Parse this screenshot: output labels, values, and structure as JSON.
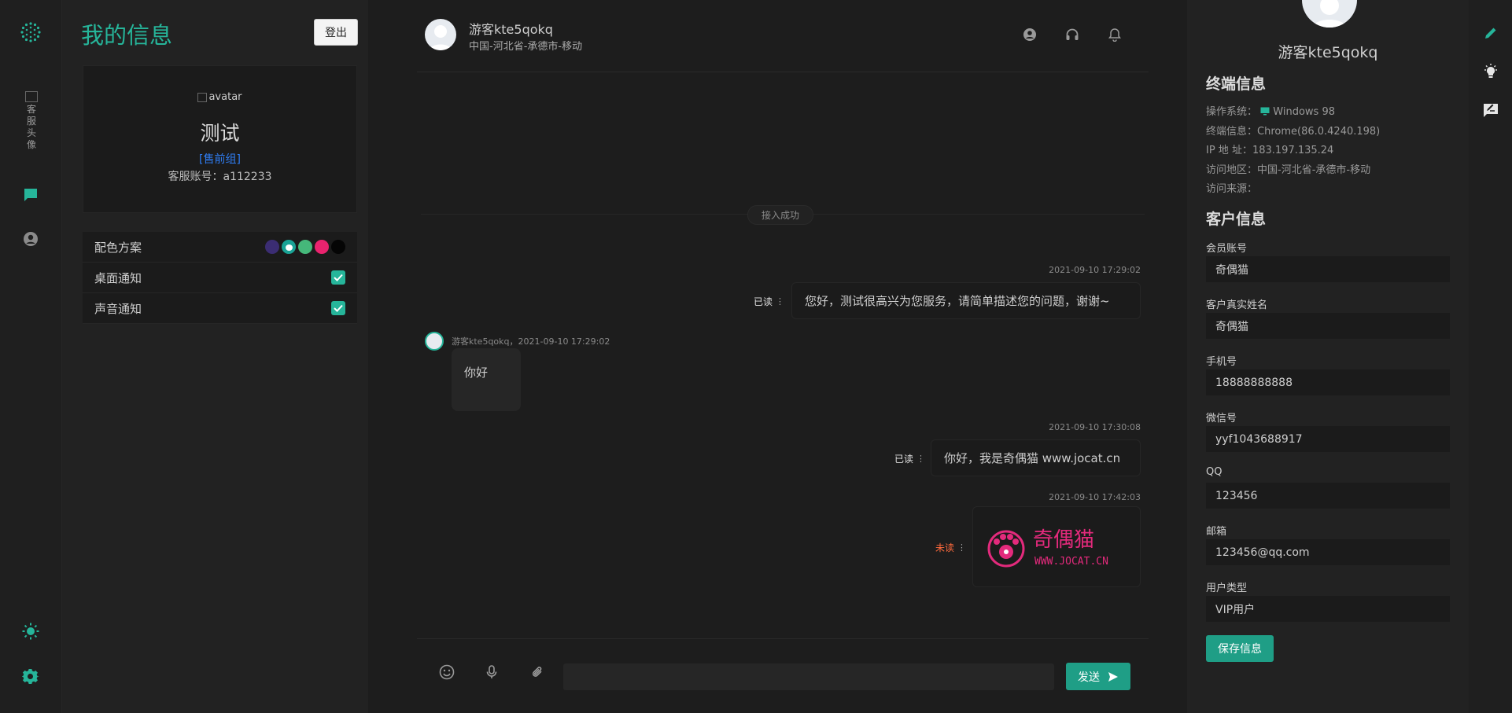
{
  "rail": {
    "avatar_alt": "客服头像",
    "icons": [
      "logo-icon",
      "chat-icon",
      "user-circle-icon",
      "sun-icon",
      "gear-icon"
    ]
  },
  "profile": {
    "title": "我的信息",
    "logout_label": "登出",
    "avatar_alt": "avatar",
    "name": "测试",
    "group": "[售前组]",
    "account": "客服账号：a112233",
    "settings": {
      "color_scheme_label": "配色方案",
      "desktop_notify_label": "桌面通知",
      "desktop_notify_checked": true,
      "sound_notify_label": "声音通知",
      "sound_notify_checked": true,
      "swatches": [
        "#3b2d73",
        "#1aa396",
        "#45b87a",
        "#e9236e",
        "#050505"
      ],
      "selected_swatch": 1
    },
    "accent": "#26b59a"
  },
  "chat": {
    "header": {
      "name": "游客kte5qokq",
      "location": "中国-河北省-承德市-移动"
    },
    "system_notice": "接入成功",
    "messages": [
      {
        "dir": "out",
        "time": "2021-09-10 17:29:02",
        "status": "已读",
        "text": "您好，测试很高兴为您服务，请简单描述您的问题，谢谢~"
      },
      {
        "dir": "in",
        "meta": "游客kte5qokq，2021-09-10 17:29:02",
        "text": "你好"
      },
      {
        "dir": "out",
        "time": "2021-09-10 17:30:08",
        "status": "已读",
        "text": "你好，我是奇偶猫 www.jocat.cn"
      },
      {
        "dir": "out",
        "time": "2021-09-10 17:42:03",
        "status": "未读",
        "image_logo_text": "奇偶猫",
        "image_url_text": "WWW.JOCAT.CN"
      }
    ],
    "composer": {
      "input_value": "",
      "send_label": "发送"
    }
  },
  "info": {
    "name": "游客kte5qokq",
    "terminal_title": "终端信息",
    "terminal": [
      {
        "label": "操作系统：",
        "value": "Windows 98"
      },
      {
        "label": "终端信息：",
        "value": "Chrome(86.0.4240.198)"
      },
      {
        "label": "IP 地 址：",
        "value": "183.197.135.24"
      },
      {
        "label": "访问地区：",
        "value": "中国-河北省-承德市-移动"
      },
      {
        "label": "访问来源：",
        "value": ""
      }
    ],
    "customer_title": "客户信息",
    "fields": [
      {
        "label": "会员账号",
        "value": "奇偶猫"
      },
      {
        "label": "客户真实姓名",
        "value": "奇偶猫"
      },
      {
        "label": "手机号",
        "value": "18888888888"
      },
      {
        "label": "微信号",
        "value": "yyf1043688917"
      },
      {
        "label": "QQ",
        "value": "123456"
      },
      {
        "label": "邮箱",
        "value": "123456@qq.com"
      },
      {
        "label": "用户类型",
        "value": "VIP用户"
      }
    ],
    "save_label": "保存信息"
  },
  "right_rail": {
    "icons": [
      "pencil-icon",
      "lightbulb-icon",
      "note-edit-icon"
    ]
  },
  "colors": {
    "accent": "#26b59a",
    "button": "#1f9e86",
    "unread": "#ff6a3d",
    "link": "#2f7ef5"
  }
}
